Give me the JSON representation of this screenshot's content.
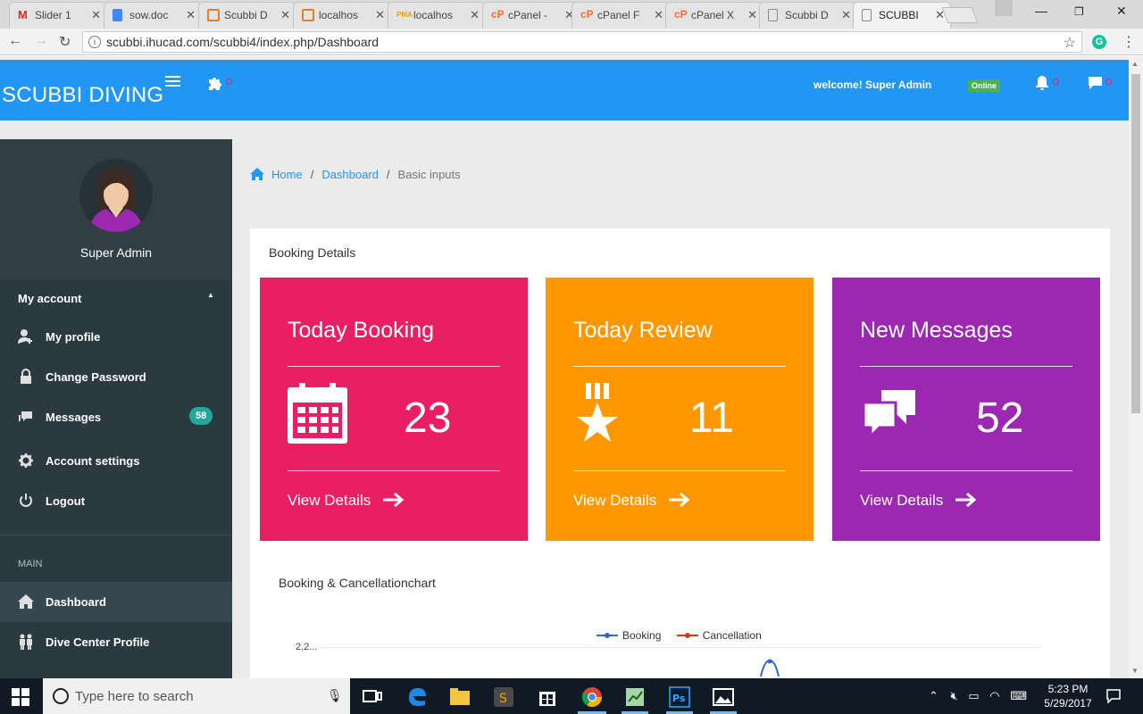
{
  "browser": {
    "tabs": [
      {
        "label": "Slider 1",
        "icon": "gmail-icon",
        "color": "#d93025"
      },
      {
        "label": "sow.doc",
        "icon": "docs-icon",
        "color": "#4285f4"
      },
      {
        "label": "Scubbi D",
        "icon": "site-icon",
        "color": "#e67e22"
      },
      {
        "label": "localhos",
        "icon": "site-icon",
        "color": "#e67e22"
      },
      {
        "label": "localhos",
        "icon": "pma-icon",
        "color": "#f0a000"
      },
      {
        "label": "cPanel -",
        "icon": "cpanel-icon",
        "color": "#ff6c2c"
      },
      {
        "label": "cPanel F",
        "icon": "cpanel-icon",
        "color": "#ff6c2c"
      },
      {
        "label": "cPanel X",
        "icon": "cpanel-icon",
        "color": "#ff6c2c"
      },
      {
        "label": "Scubbi D",
        "icon": "page-icon",
        "color": "#888888"
      },
      {
        "label": "SCUBBI",
        "icon": "page-icon",
        "color": "#888888"
      }
    ],
    "url": "scubbi.ihucad.com/scubbi4/index.php/Dashboard"
  },
  "header": {
    "brand": "SCUBBI DIVING",
    "welcome": "welcome! Super Admin",
    "status": "Online",
    "accent": "#2196f3"
  },
  "sidebar": {
    "admin_name": "Super Admin",
    "account_label": "My account",
    "account_items": [
      {
        "label": "My profile",
        "icon": "add-user-icon"
      },
      {
        "label": "Change Password",
        "icon": "lock-icon"
      },
      {
        "label": "Messages",
        "icon": "messages-icon",
        "badge": "58"
      },
      {
        "label": "Account settings",
        "icon": "gear-icon"
      },
      {
        "label": "Logout",
        "icon": "power-icon"
      }
    ],
    "section_label": "MAIN",
    "main_items": [
      {
        "label": "Dashboard",
        "icon": "home-icon"
      },
      {
        "label": "Dive Center Profile",
        "icon": "people-icon"
      }
    ]
  },
  "breadcrumb": {
    "home": "Home",
    "dashboard": "Dashboard",
    "current": "Basic inputs"
  },
  "panel": {
    "title": "Booking Details",
    "stats": [
      {
        "title": "Today Booking",
        "value": "23",
        "link": "View Details",
        "color": "#e91e63",
        "icon": "calendar-icon"
      },
      {
        "title": "Today Review",
        "value": "11",
        "link": "View Details",
        "color": "#ff9800",
        "icon": "award-icon"
      },
      {
        "title": "New Messages",
        "value": "52",
        "link": "View Details",
        "color": "#9c27b0",
        "icon": "chat-icon"
      }
    ],
    "chart_title": "Booking & Cancellationchart"
  },
  "chart_data": {
    "type": "line",
    "title": "Booking & Cancellationchart",
    "series": [
      {
        "name": "Booking",
        "color": "#3366cc"
      },
      {
        "name": "Cancellation",
        "color": "#dc3912"
      }
    ],
    "ytick_labels": [
      "2,2..."
    ]
  },
  "taskbar": {
    "search_placeholder": "Type here to search",
    "time": "5:23 PM",
    "date": "5/29/2017"
  }
}
